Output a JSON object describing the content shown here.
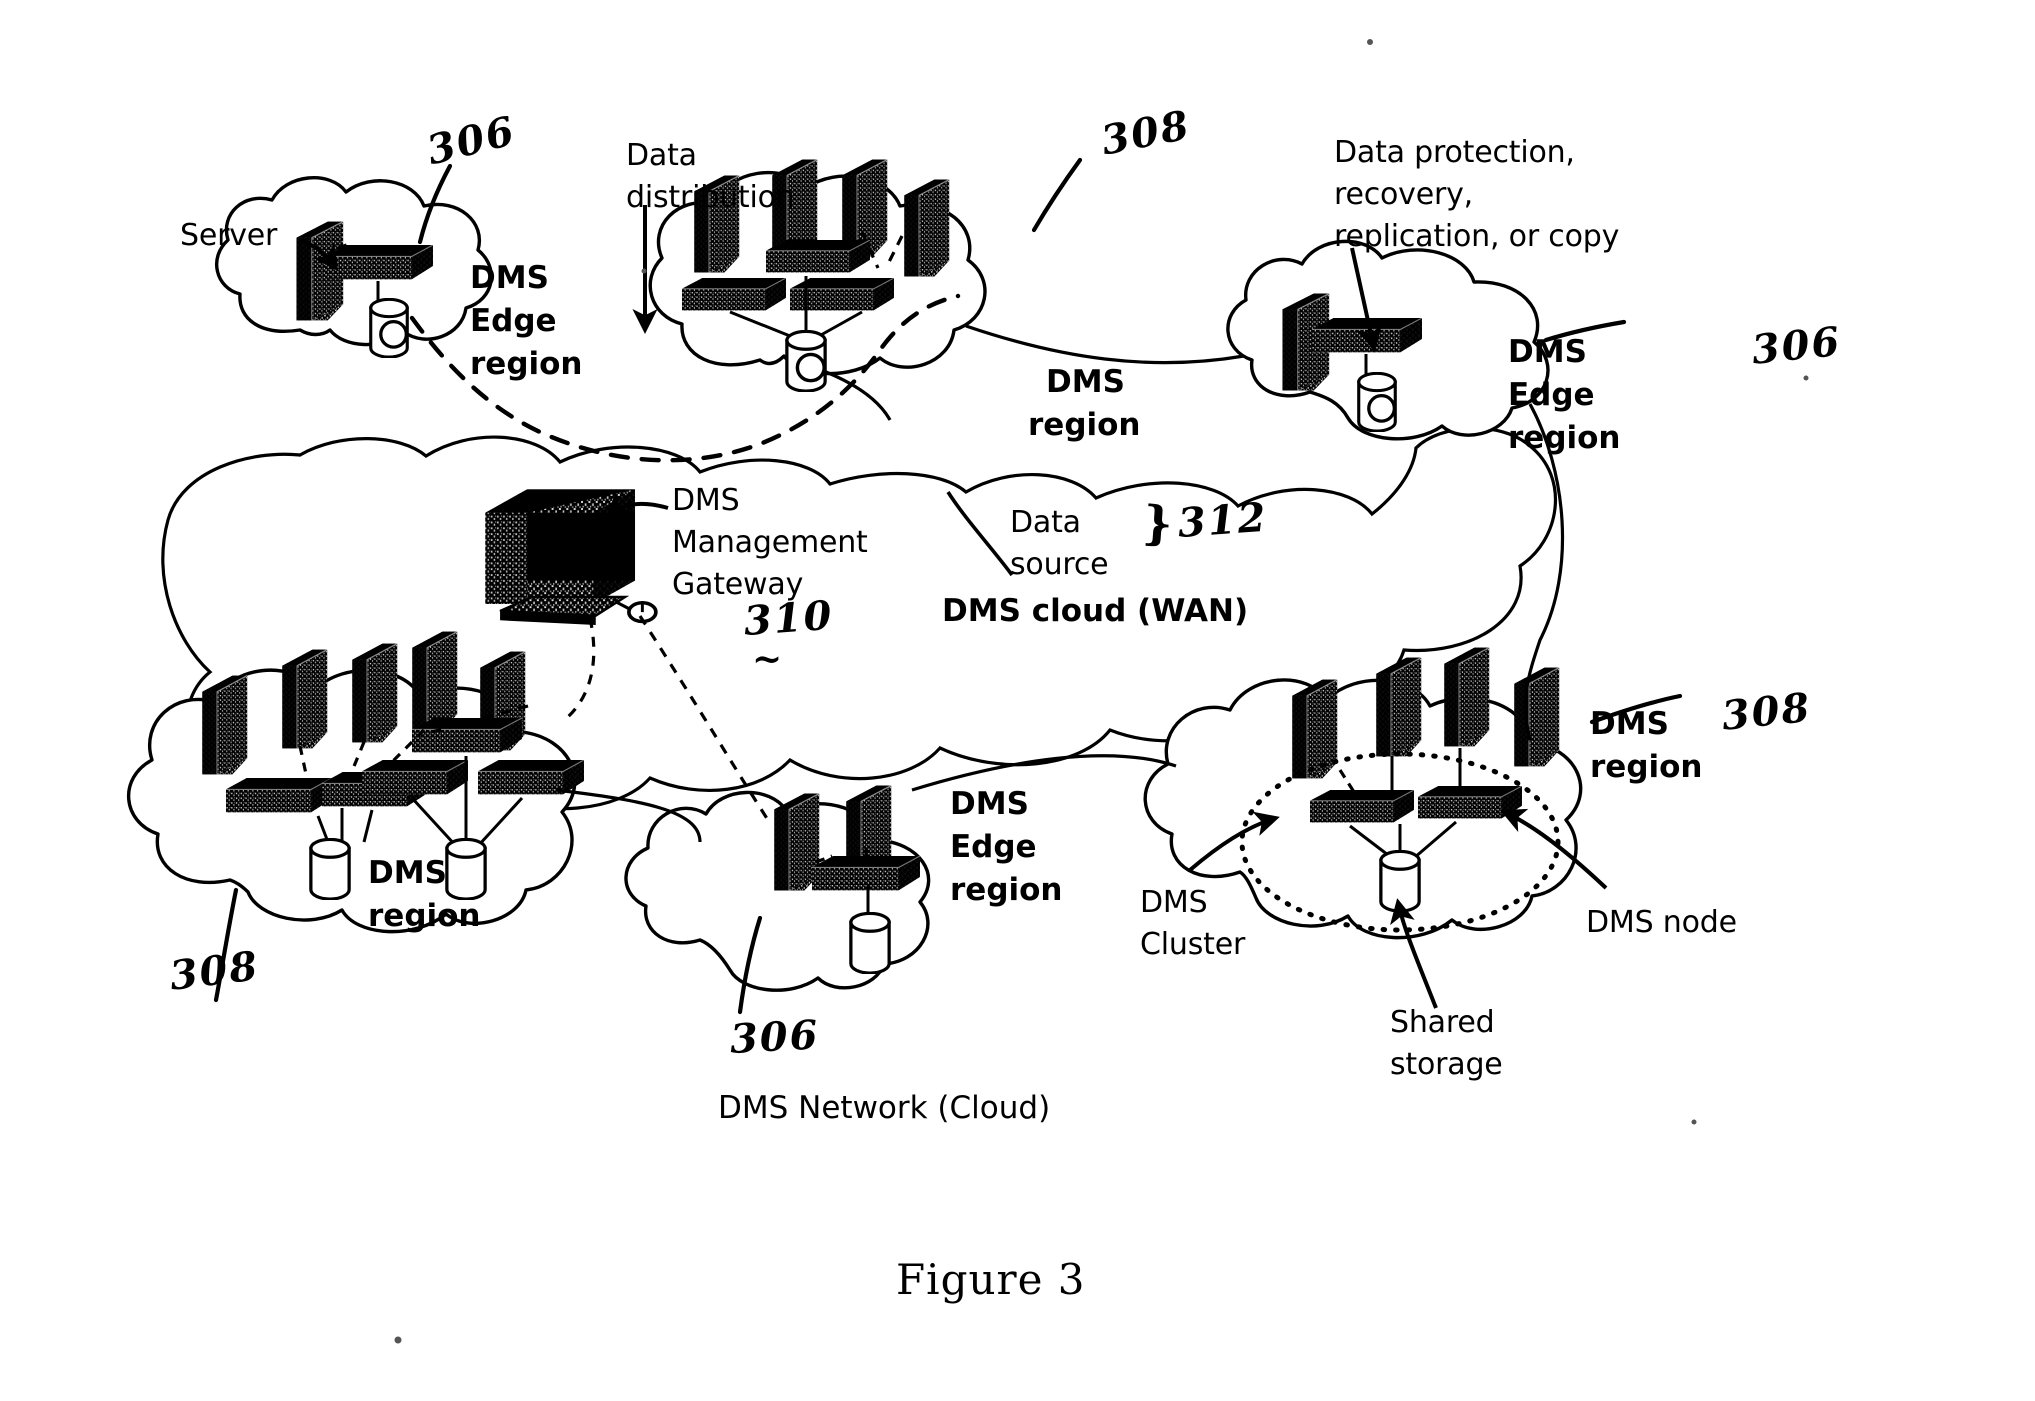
{
  "figure": {
    "caption": "Figure 3",
    "network_caption": "DMS Network (Cloud)",
    "wan_caption": "DMS cloud (WAN)"
  },
  "callouts": {
    "server": "Server",
    "data_distribution_line1": "Data",
    "data_distribution_line2": "distribution",
    "data_protection_line1": "Data protection,",
    "data_protection_line2": "recovery,",
    "data_protection_line3": "replication, or copy",
    "gateway_line1": "DMS",
    "gateway_line2": "Management",
    "gateway_line3": "Gateway",
    "data_source_line1": "Data",
    "data_source_line2": "source",
    "dms_cluster_line1": "DMS",
    "dms_cluster_line2": "Cluster",
    "dms_node": "DMS node",
    "shared_storage_line1": "Shared",
    "shared_storage_line2": "storage"
  },
  "clouds": [
    {
      "id": "edge-top-left",
      "kind": "edge",
      "label_line1": "DMS",
      "label_line2": "Edge",
      "label_line3": "region",
      "ref": "306"
    },
    {
      "id": "region-top-center",
      "kind": "region",
      "label_line1": "DMS",
      "label_line2": "region",
      "ref": "308"
    },
    {
      "id": "edge-top-right",
      "kind": "edge",
      "label_line1": "DMS",
      "label_line2": "Edge",
      "label_line3": "region",
      "ref": "306"
    },
    {
      "id": "region-bottom-left",
      "kind": "region",
      "label_line1": "DMS",
      "label_line2": "region",
      "ref": "308"
    },
    {
      "id": "edge-bottom-center",
      "kind": "edge",
      "label_line1": "DMS",
      "label_line2": "Edge",
      "label_line3": "region",
      "ref": "306"
    },
    {
      "id": "region-bottom-right",
      "kind": "region",
      "label_line1": "DMS",
      "label_line2": "region",
      "ref": "308"
    }
  ],
  "reference_numerals": {
    "n306_top_left": "306",
    "n308_top_center": "308",
    "n306_top_right": "306",
    "n312_data_source": "312",
    "n310_gateway": "310",
    "n308_bottom_left": "308",
    "n306_bottom_center": "306",
    "n308_bottom_right": "308",
    "brace_312": "}",
    "squiggle_310": "~"
  },
  "colors": {
    "ink": "#000000",
    "paper": "#ffffff",
    "shade": "#1a1a1a"
  }
}
